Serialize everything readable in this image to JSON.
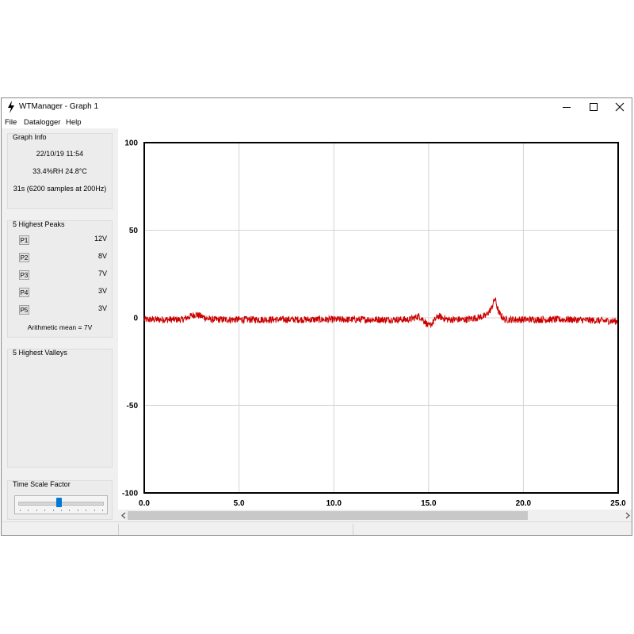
{
  "window": {
    "title": "WTManager - Graph 1"
  },
  "menu": {
    "file": "File",
    "datalogger": "Datalogger",
    "help": "Help"
  },
  "graph_info": {
    "title": "Graph Info",
    "datetime": "22/10/19   11:54",
    "climate": "33.4%RH     24.8°C",
    "duration": "31s (6200 samples at 200Hz)"
  },
  "peaks": {
    "title": "5 Highest Peaks",
    "items": [
      {
        "label": "P1",
        "value": "12V"
      },
      {
        "label": "P2",
        "value": "8V"
      },
      {
        "label": "P3",
        "value": "7V"
      },
      {
        "label": "P4",
        "value": "3V"
      },
      {
        "label": "P5",
        "value": "3V"
      }
    ],
    "mean": "Arithmetic mean = 7V"
  },
  "valleys": {
    "title": "5 Highest Valleys"
  },
  "time_scale": {
    "title": "Time Scale Factor",
    "level": 0.47
  },
  "scroll_position": 0.0,
  "colors": {
    "trace": "#cc0000",
    "slider": "#0078d7",
    "grid": "#d4d4d4"
  },
  "chart_data": {
    "type": "line",
    "title": "",
    "xlabel": "",
    "ylabel": "",
    "xlim": [
      0,
      25
    ],
    "ylim": [
      -100,
      100
    ],
    "x_ticks": [
      "0.0",
      "5.0",
      "10.0",
      "15.0",
      "20.0",
      "25.0"
    ],
    "y_ticks": [
      "100",
      "50",
      "0",
      "-50",
      "-100"
    ],
    "grid": true,
    "legend": "none",
    "series": [
      {
        "color": "#cc0000",
        "baseline": -1,
        "noise_amplitude": 2,
        "x": [
          0,
          1.0,
          2.0,
          2.7,
          3.5,
          5.0,
          7.5,
          10.0,
          12.5,
          14.0,
          14.5,
          14.8,
          15.0,
          15.2,
          15.5,
          16.0,
          17.0,
          18.0,
          18.3,
          18.5,
          18.7,
          19.0,
          20.0,
          22.5,
          25.0
        ],
        "y": [
          -1,
          -1,
          -1,
          2,
          -1,
          -1,
          -1,
          -1,
          -1,
          -1,
          1,
          -2,
          -5,
          -3,
          1,
          -1,
          -1,
          1,
          5,
          11,
          3,
          -1,
          -1,
          -1,
          -2
        ]
      }
    ]
  }
}
